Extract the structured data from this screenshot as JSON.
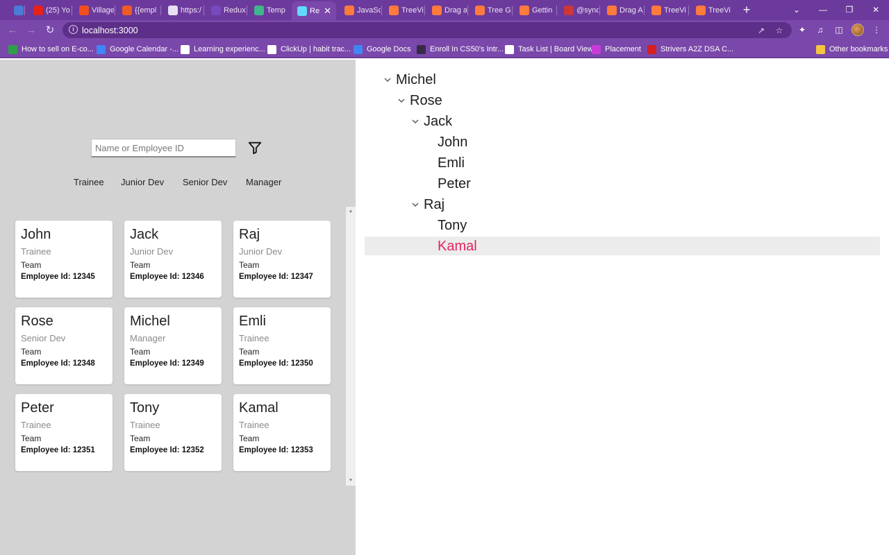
{
  "browser": {
    "tabs": [
      {
        "label": "",
        "icon": "calendar-icon",
        "color": "#4a7bd8"
      },
      {
        "label": "(25) Yo",
        "icon": "youtube-icon",
        "color": "#e62117"
      },
      {
        "label": "Village",
        "icon": "figma-icon",
        "color": "#f24e1e"
      },
      {
        "label": "{{empl",
        "icon": "postman-icon",
        "color": "#ef5b25"
      },
      {
        "label": "https:/",
        "icon": "globe-icon",
        "color": "#e8e0f2"
      },
      {
        "label": "Redux",
        "icon": "redux-icon",
        "color": "#764abc"
      },
      {
        "label": "Temp",
        "icon": "codesandbox-icon",
        "color": "#3fb68b"
      },
      {
        "label": "Re",
        "icon": "react-icon",
        "color": "#61dafb"
      },
      {
        "label": "JavaSc",
        "icon": "syncfusion-icon",
        "color": "#ff7a3d"
      },
      {
        "label": "TreeVi",
        "icon": "syncfusion-icon",
        "color": "#ff7a3d"
      },
      {
        "label": "Drag a",
        "icon": "syncfusion-icon",
        "color": "#ff7a3d"
      },
      {
        "label": "Tree G",
        "icon": "syncfusion-icon",
        "color": "#ff7a3d"
      },
      {
        "label": "Gettin",
        "icon": "syncfusion-icon",
        "color": "#ff7a3d"
      },
      {
        "label": "@sync",
        "icon": "npm-icon",
        "color": "#cb3837"
      },
      {
        "label": "Drag A",
        "icon": "syncfusion-icon",
        "color": "#ff7a3d"
      },
      {
        "label": "TreeVi",
        "icon": "syncfusion-icon",
        "color": "#ff7a3d"
      },
      {
        "label": "TreeVi",
        "icon": "syncfusion-icon",
        "color": "#ff7a3d"
      }
    ],
    "url": "localhost:3000",
    "bookmarks": [
      {
        "label": "How to sell on E-co...",
        "icon": "site-icon",
        "color": "#2e9e4a"
      },
      {
        "label": "Google Calendar -...",
        "icon": "calendar-icon",
        "color": "#4285f4"
      },
      {
        "label": "Learning experienc...",
        "icon": "learning-icon",
        "color": "#ffffff"
      },
      {
        "label": "ClickUp | habit trac...",
        "icon": "clickup-icon",
        "color": "#ffffff"
      },
      {
        "label": "Google Docs",
        "icon": "docs-icon",
        "color": "#4285f4"
      },
      {
        "label": "Enroll In CS50's Intr...",
        "icon": "edx-icon",
        "color": "#3a2a4a"
      },
      {
        "label": "Task List | Board View",
        "icon": "check-icon",
        "color": "#ffffff"
      },
      {
        "label": "Placement",
        "icon": "placement-icon",
        "color": "#c93bd8"
      },
      {
        "label": "Strivers A2Z DSA C...",
        "icon": "tuf-icon",
        "color": "#d61f1f"
      }
    ],
    "other_bookmarks": "Other bookmarks"
  },
  "filters": {
    "search_placeholder": "Name or Employee ID",
    "roles": [
      "Trainee",
      "Junior Dev",
      "Senior Dev",
      "Manager"
    ]
  },
  "employees": [
    {
      "name": "John",
      "role": "Trainee",
      "team": "Team",
      "employee_id": "Employee Id: 12345"
    },
    {
      "name": "Jack",
      "role": "Junior Dev",
      "team": "Team",
      "employee_id": "Employee Id: 12346"
    },
    {
      "name": "Raj",
      "role": "Junior Dev",
      "team": "Team",
      "employee_id": "Employee Id: 12347"
    },
    {
      "name": "Rose",
      "role": "Senior Dev",
      "team": "Team",
      "employee_id": "Employee Id: 12348"
    },
    {
      "name": "Michel",
      "role": "Manager",
      "team": "Team",
      "employee_id": "Employee Id: 12349"
    },
    {
      "name": "Emli",
      "role": "Trainee",
      "team": "Team",
      "employee_id": "Employee Id: 12350"
    },
    {
      "name": "Peter",
      "role": "Trainee",
      "team": "Team",
      "employee_id": "Employee Id: 12351"
    },
    {
      "name": "Tony",
      "role": "Trainee",
      "team": "Team",
      "employee_id": "Employee Id: 12352"
    },
    {
      "name": "Kamal",
      "role": "Trainee",
      "team": "Team",
      "employee_id": "Employee Id: 12353"
    }
  ],
  "tree": [
    {
      "label": "Michel",
      "depth": 0,
      "expandable": true,
      "selected": false
    },
    {
      "label": "Rose",
      "depth": 1,
      "expandable": true,
      "selected": false
    },
    {
      "label": "Jack",
      "depth": 2,
      "expandable": true,
      "selected": false
    },
    {
      "label": "John",
      "depth": 3,
      "expandable": false,
      "selected": false
    },
    {
      "label": "Emli",
      "depth": 3,
      "expandable": false,
      "selected": false
    },
    {
      "label": "Peter",
      "depth": 3,
      "expandable": false,
      "selected": false
    },
    {
      "label": "Raj",
      "depth": 2,
      "expandable": true,
      "selected": false
    },
    {
      "label": "Tony",
      "depth": 3,
      "expandable": false,
      "selected": false
    },
    {
      "label": "Kamal",
      "depth": 3,
      "expandable": false,
      "selected": true
    }
  ],
  "colors": {
    "chrome_purple": "#7a48aa",
    "left_panel_bg": "#d3d3d3",
    "selected_node": "#e0245e",
    "selected_row_bg": "#ececec"
  }
}
